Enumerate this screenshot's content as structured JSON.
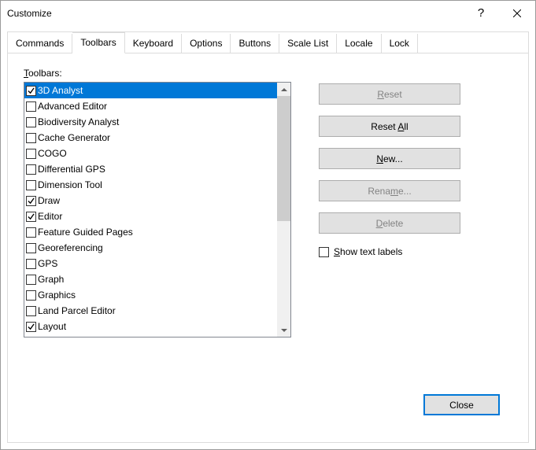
{
  "window": {
    "title": "Customize",
    "help": "?",
    "close": "✕"
  },
  "tabs": {
    "items": [
      {
        "label": "Commands"
      },
      {
        "label": "Toolbars"
      },
      {
        "label": "Keyboard"
      },
      {
        "label": "Options"
      },
      {
        "label": "Buttons"
      },
      {
        "label": "Scale List"
      },
      {
        "label": "Locale"
      },
      {
        "label": "Lock"
      }
    ]
  },
  "panel": {
    "section_label_u": "T",
    "section_label_rest": "oolbars:"
  },
  "toolbars": [
    {
      "label": "3D Analyst",
      "checked": true,
      "selected": true
    },
    {
      "label": "Advanced Editor",
      "checked": false,
      "selected": false
    },
    {
      "label": "Biodiversity Analyst",
      "checked": false,
      "selected": false
    },
    {
      "label": "Cache Generator",
      "checked": false,
      "selected": false
    },
    {
      "label": "COGO",
      "checked": false,
      "selected": false
    },
    {
      "label": "Differential GPS",
      "checked": false,
      "selected": false
    },
    {
      "label": "Dimension Tool",
      "checked": false,
      "selected": false
    },
    {
      "label": "Draw",
      "checked": true,
      "selected": false
    },
    {
      "label": "Editor",
      "checked": true,
      "selected": false
    },
    {
      "label": "Feature Guided Pages",
      "checked": false,
      "selected": false
    },
    {
      "label": "Georeferencing",
      "checked": false,
      "selected": false
    },
    {
      "label": "GPS",
      "checked": false,
      "selected": false
    },
    {
      "label": "Graph",
      "checked": false,
      "selected": false
    },
    {
      "label": "Graphics",
      "checked": false,
      "selected": false
    },
    {
      "label": "Land Parcel Editor",
      "checked": false,
      "selected": false
    },
    {
      "label": "Layout",
      "checked": true,
      "selected": false
    }
  ],
  "buttons": {
    "reset_u": "R",
    "reset_rest": "eset",
    "resetall_pre": "Reset ",
    "resetall_u": "A",
    "resetall_post": "ll",
    "new_u": "N",
    "new_rest": "ew...",
    "rename_pre": "Rena",
    "rename_u": "m",
    "rename_post": "e...",
    "delete_u": "D",
    "delete_rest": "elete"
  },
  "showlabels": {
    "pre": "",
    "u": "S",
    "post": "how text labels"
  },
  "footer": {
    "close": "Close"
  }
}
